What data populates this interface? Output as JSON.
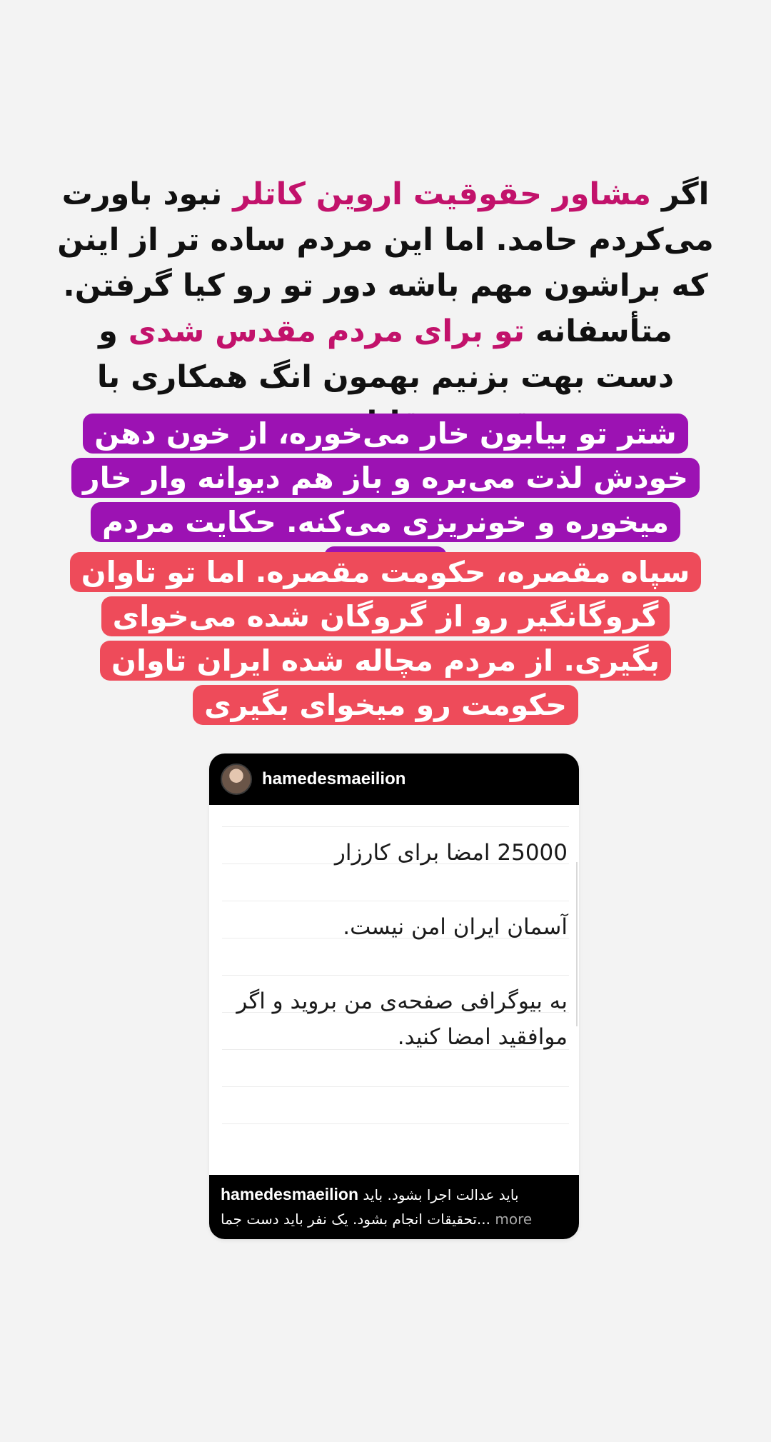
{
  "headline": {
    "p1": "اگر ",
    "p2": "مشاور حقوقیت اروین کاتلر",
    "p3": " نبود باورت می‌کردم حامد. اما این مردم ساده تر از اینن که براشون مهم باشه دور تو رو کیا گرفتن. متأسفانه ",
    "p4": "تو برای مردم مقدس شدی",
    "p5": " و دست بهت بزنیم بهمون انگ همکاری با مقصر و قاتل می‌زنند."
  },
  "purple_block": {
    "text": "شتر تو بیابون خار می‌خوره، از خون دهن خودش لذت می‌بره و باز هم دیوانه وار خار میخوره و خونریزی می‌کنه. حکایت مردم ماست.",
    "color": "#9c12b3"
  },
  "red_block": {
    "text": "سپاه مقصره، حکومت مقصره. اما تو تاوان گروگانگیر رو از گروگان شده می‌خوای بگیری. از مردم مچاله شده ایران تاوان حکومت رو میخوای بگیری",
    "color": "#ee4b5a"
  },
  "post": {
    "username": "hamedesmaeilion",
    "avatar_icon": "user-avatar",
    "body_lines": [
      "25000 امضا برای کارزار",
      "آسمان ایران امن نیست.",
      "به بیوگرافی صفحه‌ی من بروید و اگر موافقید امضا کنید."
    ],
    "caption_user": "hamedesmaeilion",
    "caption_line1": "باید عدالت اجرا بشود. باید",
    "caption_line2": "تحقیقات انجام بشود. یک نفر باید دست جما...",
    "caption_more": "more"
  },
  "colors": {
    "background": "#f3f3f3",
    "highlight_text": "#c2126b"
  }
}
